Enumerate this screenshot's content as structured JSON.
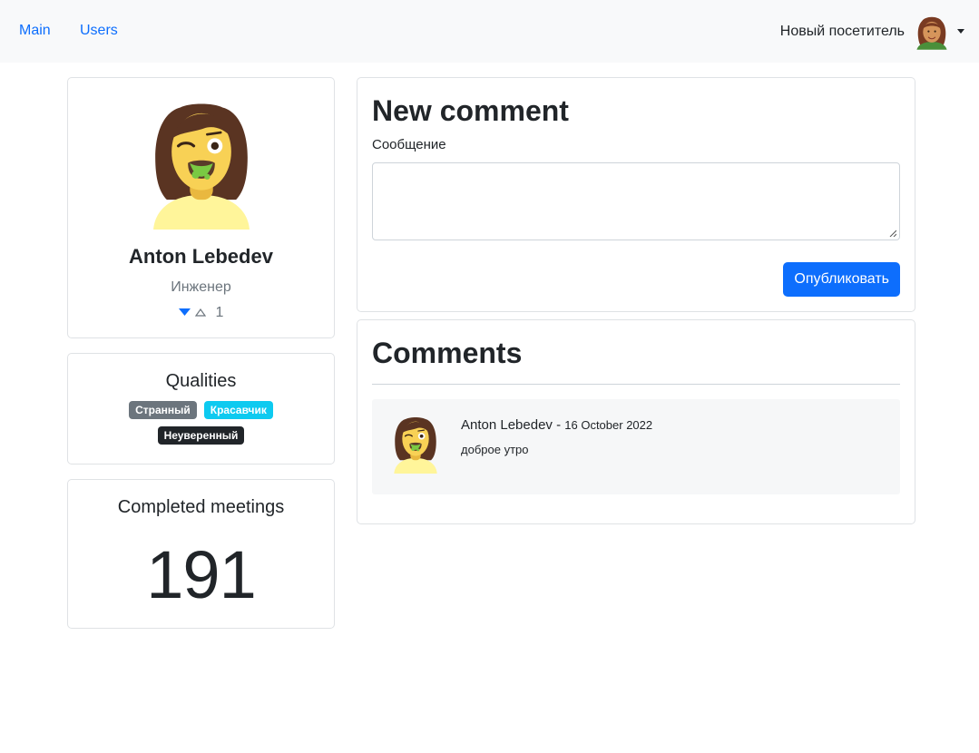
{
  "nav": {
    "links": [
      {
        "label": "Main"
      },
      {
        "label": "Users"
      }
    ],
    "user_name": "Новый посетитель"
  },
  "profile": {
    "name": "Anton Lebedev",
    "profession": "Инженер",
    "rate": "1"
  },
  "qualities": {
    "title": "Qualities",
    "items": [
      {
        "label": "Странный",
        "color": "#6c757d"
      },
      {
        "label": "Красавчик",
        "color": "#0dcaf0"
      },
      {
        "label": "Неуверенный",
        "color": "#212529"
      }
    ]
  },
  "meetings": {
    "title": "Completed meetings",
    "count": "191"
  },
  "new_comment": {
    "title": "New comment",
    "message_label": "Сообщение",
    "message_value": "",
    "submit_label": "Опубликовать"
  },
  "comments": {
    "title": "Comments",
    "items": [
      {
        "author": "Anton Lebedev",
        "separator": " - ",
        "date": "16 October 2022",
        "text": "доброе утро"
      }
    ]
  },
  "colors": {
    "primary": "#0d6efd",
    "navbar_bg": "#f8f9fa",
    "comment_bg": "#f6f7f8"
  }
}
